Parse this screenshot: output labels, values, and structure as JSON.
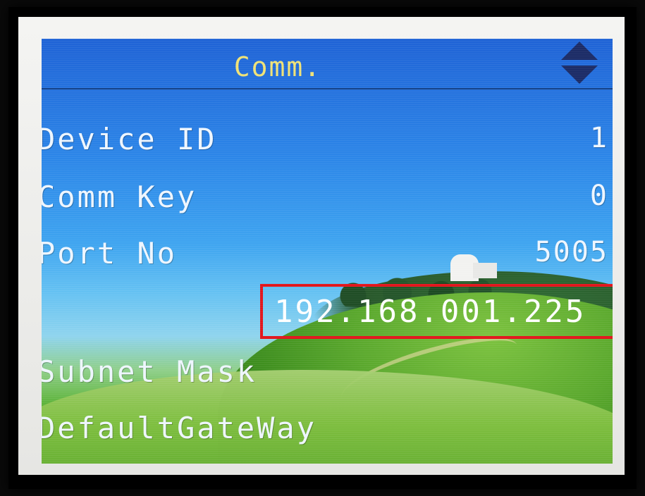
{
  "screen": {
    "title": "Comm.",
    "fields": [
      {
        "label": "Device ID",
        "value": "1"
      },
      {
        "label": "Comm Key",
        "value": "0"
      },
      {
        "label": "Port No",
        "value": "5005"
      },
      {
        "label": "",
        "value": "192.168.001.225"
      },
      {
        "label": "Subnet Mask",
        "value": ""
      },
      {
        "label": "DefaultGateWay",
        "value": ""
      }
    ],
    "scroll_icon": "up-down-arrows-icon",
    "selected_field_index": 3
  },
  "colors": {
    "title_text": "#f0e276",
    "highlight_border": "#e2141b",
    "field_text": "#eef6ff"
  }
}
